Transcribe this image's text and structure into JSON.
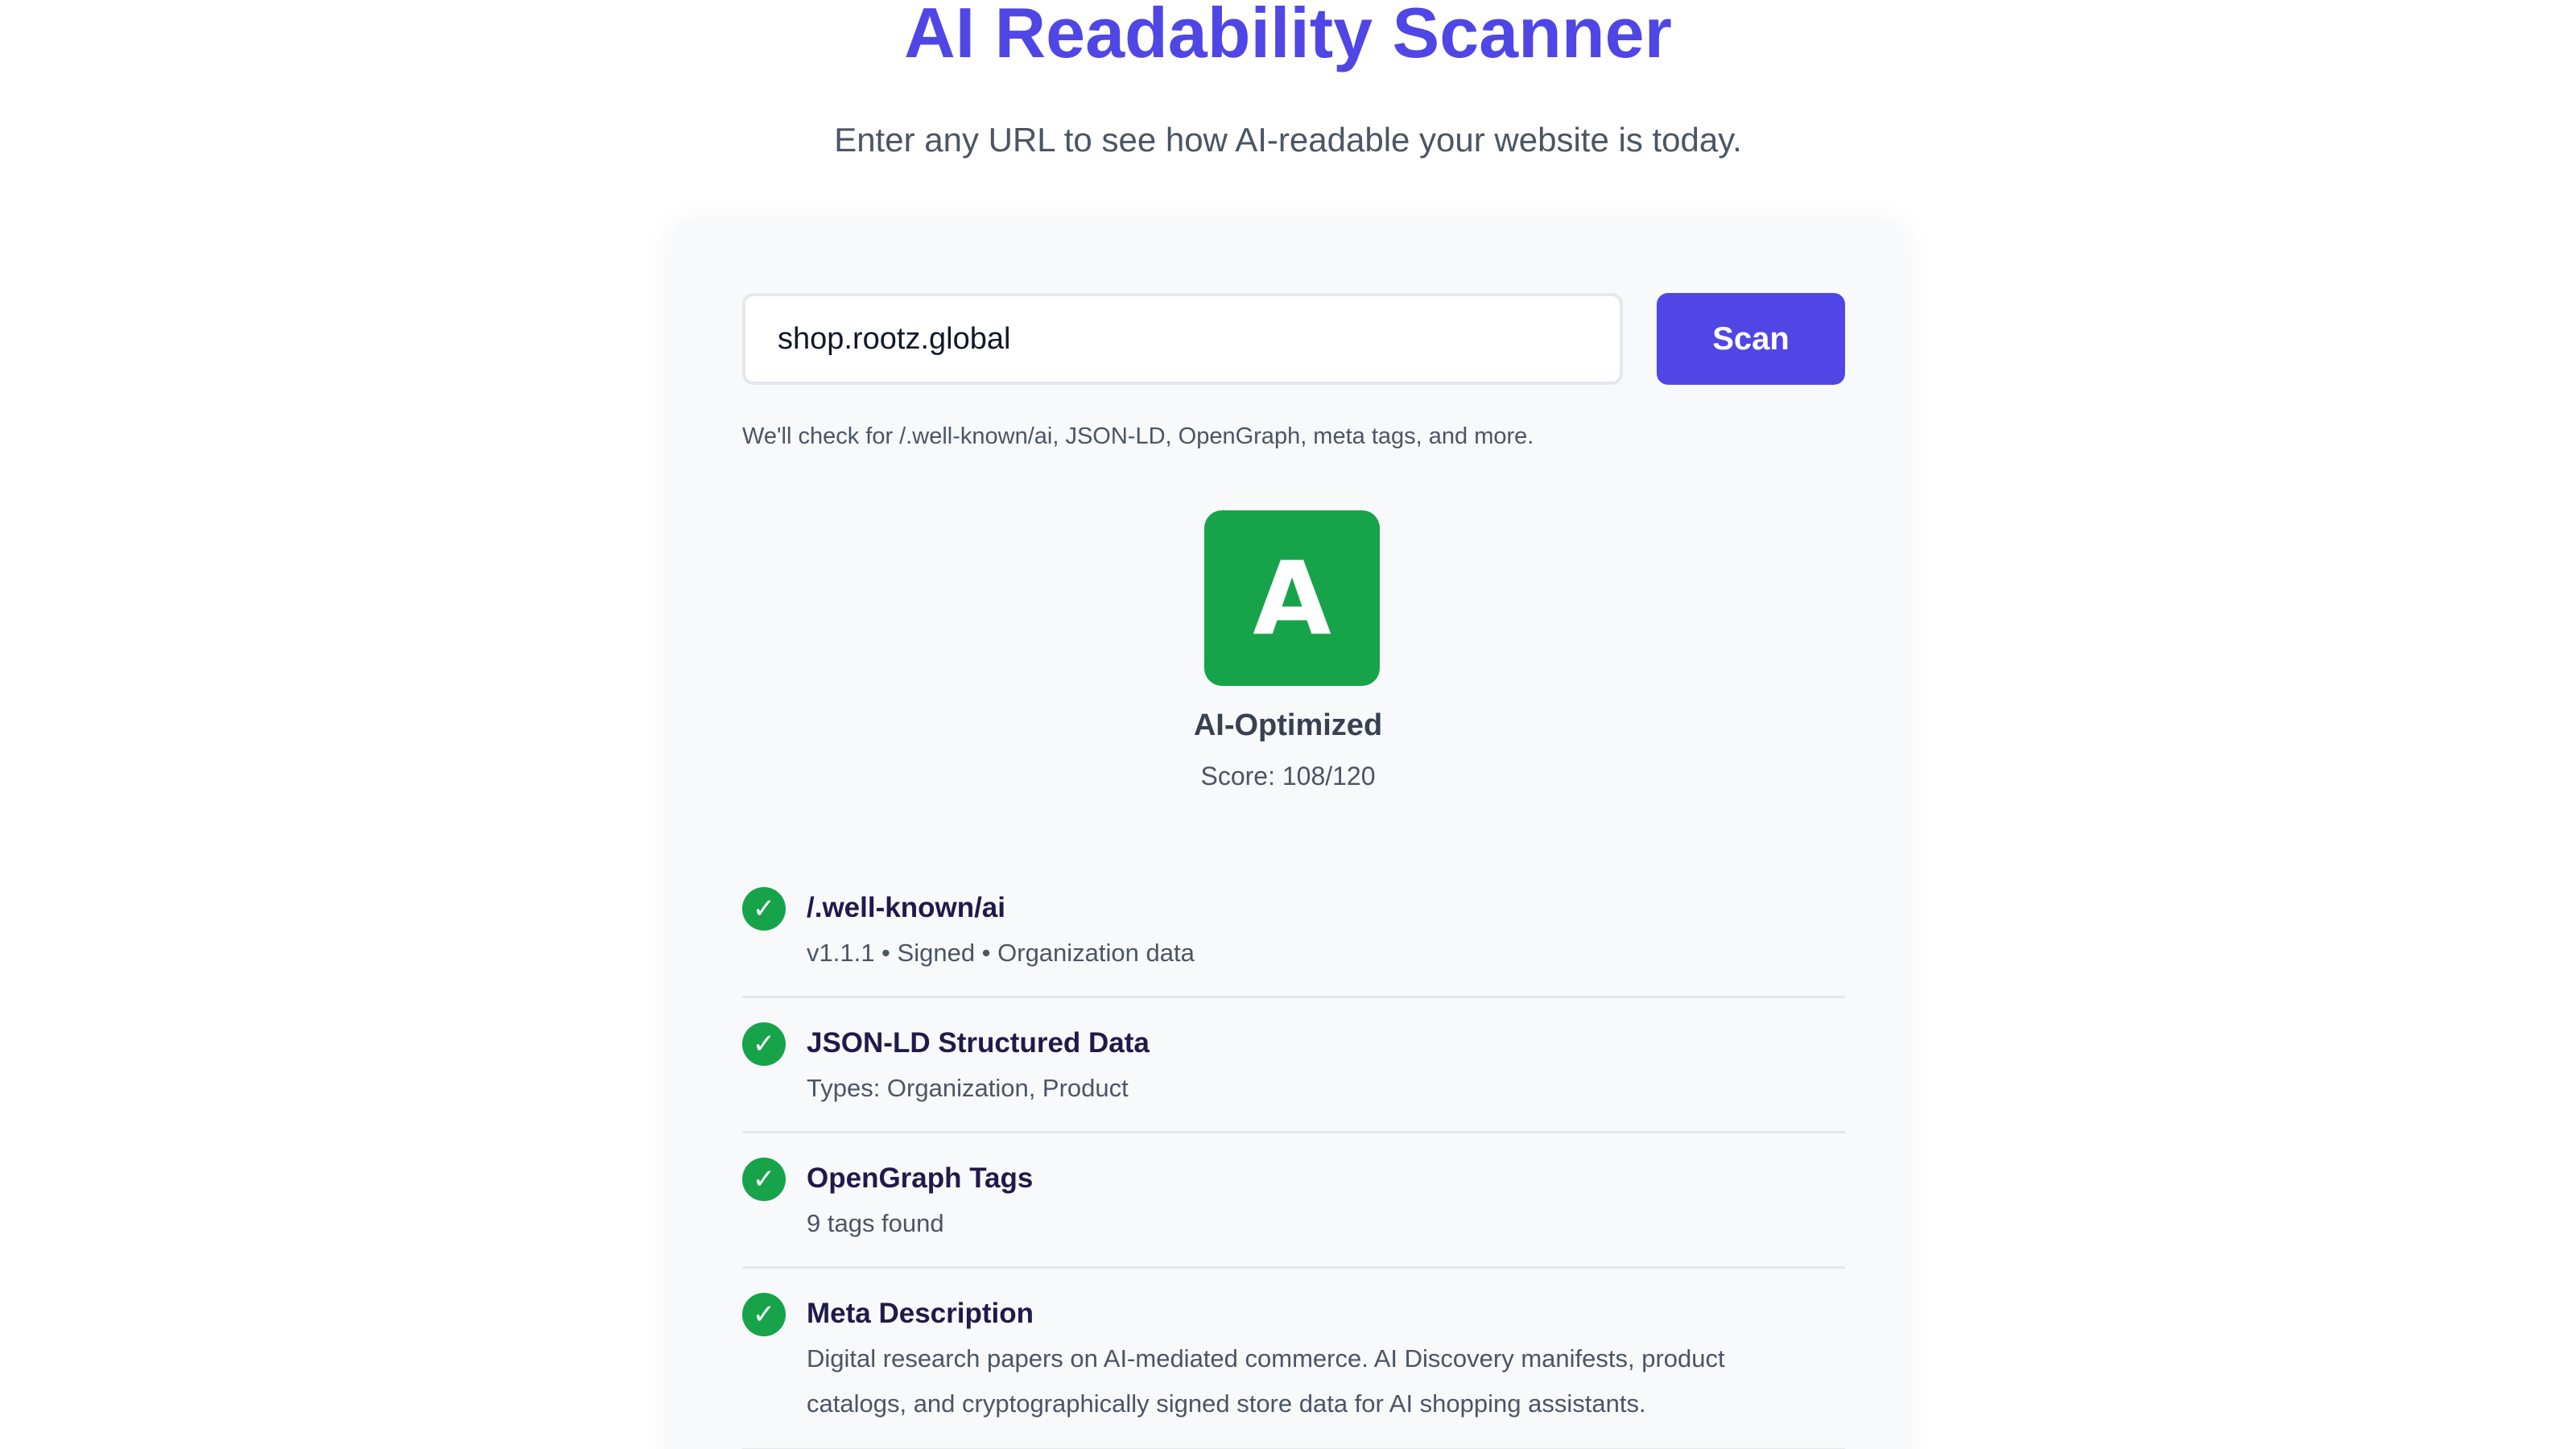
{
  "header": {
    "title": "AI Readability Scanner",
    "subtitle": "Enter any URL to see how AI-readable your website is today."
  },
  "scan_form": {
    "url_value": "shop.rootz.global",
    "button_label": "Scan",
    "hint": "We'll check for /.well-known/ai, JSON-LD, OpenGraph, meta tags, and more."
  },
  "result": {
    "grade": "A",
    "grade_color": "#16a34a",
    "label": "AI-Optimized",
    "score_text": "Score: 108/120"
  },
  "checks": [
    {
      "status_icon": "check-icon",
      "title": "/.well-known/ai",
      "detail": "v1.1.1 • Signed • Organization data"
    },
    {
      "status_icon": "check-icon",
      "title": "JSON-LD Structured Data",
      "detail": "Types: Organization, Product"
    },
    {
      "status_icon": "check-icon",
      "title": "OpenGraph Tags",
      "detail": "9 tags found"
    },
    {
      "status_icon": "check-icon",
      "title": "Meta Description",
      "detail": "Digital research papers on AI-mediated commerce. AI Discovery manifests, product catalogs, and cryptographically signed store data for AI shopping assistants."
    }
  ],
  "colors": {
    "accent": "#4f46e5",
    "success": "#16a34a"
  }
}
